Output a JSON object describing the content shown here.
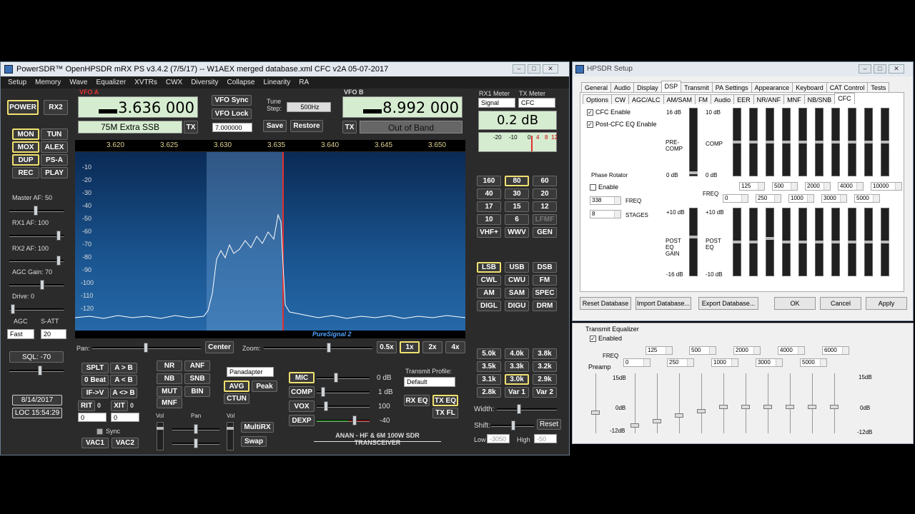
{
  "main": {
    "title": "PowerSDR™ OpenHPSDR mRX PS v3.4.2 (7/5/17)  --  W1AEX merged database.xml CFC v2A 05-07-2017",
    "menu": [
      "Setup",
      "Memory",
      "Wave",
      "Equalizer",
      "XVTRs",
      "CWX",
      "Diversity",
      "Collapse",
      "Linearity",
      "RA"
    ],
    "power": "POWER",
    "rx2": "RX2",
    "left_buttons": [
      "MON",
      "TUN",
      "MOX",
      "ALEX",
      "DUP",
      "PS-A",
      "REC",
      "PLAY"
    ],
    "master_af": "Master AF:  50",
    "rx1_af": "RX1 AF:  100",
    "rx2_af": "RX2 AF:  100",
    "agc_gain": "AGC Gain:  70",
    "drive": "Drive:  0",
    "agc": "AGC",
    "satt": "S-ATT",
    "agc_mode": "Fast",
    "satt_val": "20",
    "sql": "SQL:  -70",
    "date": "8/14/2017",
    "time": "LOC 15:54:29",
    "vfoa_label": "VFO A",
    "vfoa_freq": "3.636 000",
    "vfoa_band": "75M Extra SSB",
    "tx": "TX",
    "vfo_sync": "VFO Sync",
    "vfo_lock": "VFO Lock",
    "tune_step": "Tune Step:",
    "step_val": "500Hz",
    "step_freq": "7.000000",
    "save": "Save",
    "restore": "Restore",
    "vfob_label": "VFO B",
    "vfob_freq": "8.992 000",
    "vfob_band": "Out of Band",
    "rx1_meter": "RX1 Meter",
    "tx_meter": "TX Meter",
    "rx1_sel": "Signal",
    "tx_sel": "CFC",
    "meter_val": "0.2 dB",
    "meter_ticks": [
      "-20",
      "-10",
      "0",
      "4",
      "8",
      "12"
    ],
    "freq_ticks": [
      "3.620",
      "3.625",
      "3.630",
      "3.635",
      "3.640",
      "3.645",
      "3.650"
    ],
    "db_ticks": [
      "-10",
      "-20",
      "-30",
      "-40",
      "-50",
      "-60",
      "-70",
      "-80",
      "-90",
      "-100",
      "-110",
      "-120"
    ],
    "puresignal": "PureSignal 2",
    "pan": "Pan:",
    "center": "Center",
    "zoom": "Zoom:",
    "zooms": [
      "0.5x",
      "1x",
      "2x",
      "4x"
    ],
    "bands": [
      "160",
      "80",
      "60",
      "40",
      "30",
      "20",
      "17",
      "15",
      "12",
      "10",
      "6",
      "LFMF",
      "VHF+",
      "WWV",
      "GEN"
    ],
    "modes": [
      "LSB",
      "USB",
      "DSB",
      "CWL",
      "CWU",
      "FM",
      "AM",
      "SAM",
      "SPEC",
      "DIGL",
      "DIGU",
      "DRM"
    ],
    "filters": [
      "5.0k",
      "4.0k",
      "3.8k",
      "3.5k",
      "3.3k",
      "3.2k",
      "3.1k",
      "3.0k",
      "2.9k",
      "2.8k",
      "Var 1",
      "Var 2"
    ],
    "width": "Width:",
    "shift": "Shift:",
    "reset": "Reset",
    "low": "Low",
    "high": "High",
    "low_val": "-3050",
    "high_val": "-50",
    "splt": "SPLT",
    "a2b": "A > B",
    "zerobeat": "0 Beat",
    "b2a": "A < B",
    "ifv": "IF->V",
    "swap_ab": "A <> B",
    "rit": "RIT",
    "rit_val": "0",
    "xit": "XIT",
    "xit_val": "0",
    "rit_num": "0",
    "xit_num": "0",
    "sync": "Sync",
    "vac1": "VAC1",
    "vac2": "VAC2",
    "dsp": [
      "NR",
      "ANF",
      "NB",
      "SNB",
      "MUT",
      "BIN",
      "MNF"
    ],
    "display_mode": "Panadapter",
    "avg": "AVG",
    "peak": "Peak",
    "ctun": "CTUN",
    "vol": "Vol",
    "panl": "Pan",
    "vol2": "Vol",
    "multirx": "MultiRX",
    "swap": "Swap",
    "mic": "MIC",
    "mic_val": "0 dB",
    "comp": "COMP",
    "comp_val": "1 dB",
    "vox": "VOX",
    "vox_val": "100",
    "dexp": "DEXP",
    "dexp_val": "-40",
    "tx_profile": "Transmit Profile:",
    "profile_val": "Default",
    "rxeq": "RX EQ",
    "txeq": "TX EQ",
    "txfl": "TX FL",
    "anan": "ANAN - HF & 6M 100W SDR TRANSCEIVER"
  },
  "setup": {
    "title": "HPSDR Setup",
    "tabs1": [
      "General",
      "Audio",
      "Display",
      "DSP",
      "Transmit",
      "PA Settings",
      "Appearance",
      "Keyboard",
      "CAT Control",
      "Tests"
    ],
    "tabs2": [
      "Options",
      "CW",
      "AGC/ALC",
      "AM/SAM",
      "FM",
      "Audio",
      "EER",
      "NR/ANF",
      "MNF",
      "NB/SNB",
      "CFC"
    ],
    "cfc_enable": "CFC Enable",
    "post_eq_enable": "Post-CFC EQ Enable",
    "pre_top": "16 dB",
    "pre_bot": "0 dB",
    "pre_label": "PRE-\nCOMP",
    "comp_top": "10 dB",
    "comp_bot": "0 dB",
    "comp_label": "COMP",
    "phase_rot": "Phase Rotator",
    "phase_enable": "Enable",
    "freq_val": "338",
    "freq_lbl": "FREQ",
    "stages_val": "8",
    "stages_lbl": "STAGES",
    "freq": "FREQ",
    "freqs_top": [
      "125",
      "500",
      "2000",
      "4000",
      "10000"
    ],
    "freqs_bot": [
      "0",
      "250",
      "1000",
      "3000",
      "5000"
    ],
    "post_top": "+10 dB",
    "post_bot": "-16 dB",
    "post_label": "POST\nEQ\nGAIN",
    "posteq_top": "+10 dB",
    "posteq_bot": "-10 dB",
    "posteq_label": "POST\nEQ",
    "reset_db": "Reset Database",
    "import_db": "Import Database...",
    "export_db": "Export Database...",
    "ok": "OK",
    "cancel": "Cancel",
    "apply": "Apply"
  },
  "txeq": {
    "title": "Transmit Equalizer",
    "enabled": "Enabled",
    "freq": "FREQ",
    "preamp": "Preamp",
    "freqs_top": [
      "125",
      "500",
      "2000",
      "4000",
      "6000"
    ],
    "freqs_bot": [
      "0",
      "250",
      "1000",
      "3000",
      "5000"
    ],
    "top": "15dB",
    "mid": "0dB",
    "bot": "-12dB",
    "top_r": "15dB",
    "mid_r": "0dB",
    "bot_r": "-12dB"
  }
}
